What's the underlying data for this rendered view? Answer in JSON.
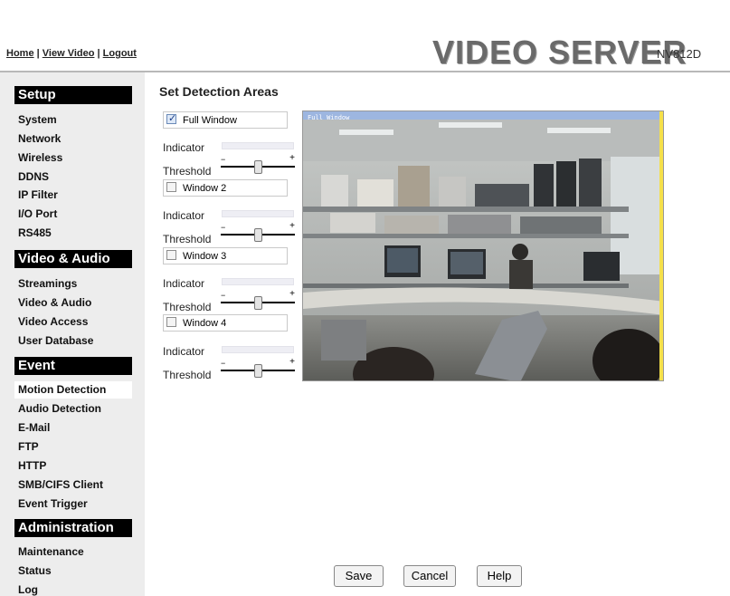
{
  "header": {
    "links": [
      "Home",
      "View Video",
      "Logout"
    ],
    "separator": "|",
    "product_name": "VIDEO SERVER",
    "model": "NV812D"
  },
  "sidebar": {
    "sections": [
      {
        "title": "Setup",
        "items": [
          "System",
          "Network",
          "Wireless",
          "DDNS",
          "IP Filter",
          "I/O Port",
          "RS485"
        ]
      },
      {
        "title": "Video & Audio",
        "items": [
          "Streamings",
          "Video & Audio",
          "Video Access",
          "User Database"
        ]
      },
      {
        "title": "Event",
        "items": [
          "Motion Detection",
          "Audio Detection",
          "E-Mail",
          "FTP",
          "HTTP",
          "SMB/CIFS Client",
          "Event Trigger"
        ]
      },
      {
        "title": "Administration",
        "items": [
          "Maintenance",
          "Status",
          "Log"
        ]
      }
    ],
    "active_item": "Motion Detection"
  },
  "main": {
    "title": "Set Detection Areas",
    "indicator_label": "Indicator",
    "threshold_label": "Threshold",
    "slider_min_symbol": "−",
    "slider_max_symbol": "+",
    "windows": [
      {
        "name": "Full Window",
        "checked": true,
        "threshold": 0.5
      },
      {
        "name": "Window 2",
        "checked": false,
        "threshold": 0.5
      },
      {
        "name": "Window 3",
        "checked": false,
        "threshold": 0.5
      },
      {
        "name": "Window 4",
        "checked": false,
        "threshold": 0.5
      }
    ],
    "camera_overlay_label": "Full Window"
  },
  "buttons": {
    "save": "Save",
    "cancel": "Cancel",
    "help": "Help"
  }
}
